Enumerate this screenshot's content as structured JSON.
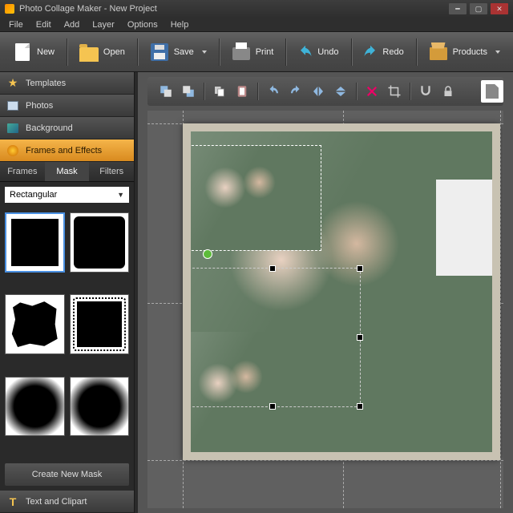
{
  "window": {
    "title": "Photo Collage Maker - New Project"
  },
  "menu": {
    "file": "File",
    "edit": "Edit",
    "add": "Add",
    "layer": "Layer",
    "options": "Options",
    "help": "Help"
  },
  "toolbar": {
    "new": "New",
    "open": "Open",
    "save": "Save",
    "print": "Print",
    "undo": "Undo",
    "redo": "Redo",
    "products": "Products"
  },
  "sidebar": {
    "templates": "Templates",
    "photos": "Photos",
    "background": "Background",
    "frames_effects": "Frames and Effects",
    "text_clipart": "Text and Clipart",
    "subtabs": {
      "frames": "Frames",
      "mask": "Mask",
      "filters": "Filters"
    },
    "mask_dropdown": "Rectangular",
    "create_mask": "Create New Mask"
  }
}
